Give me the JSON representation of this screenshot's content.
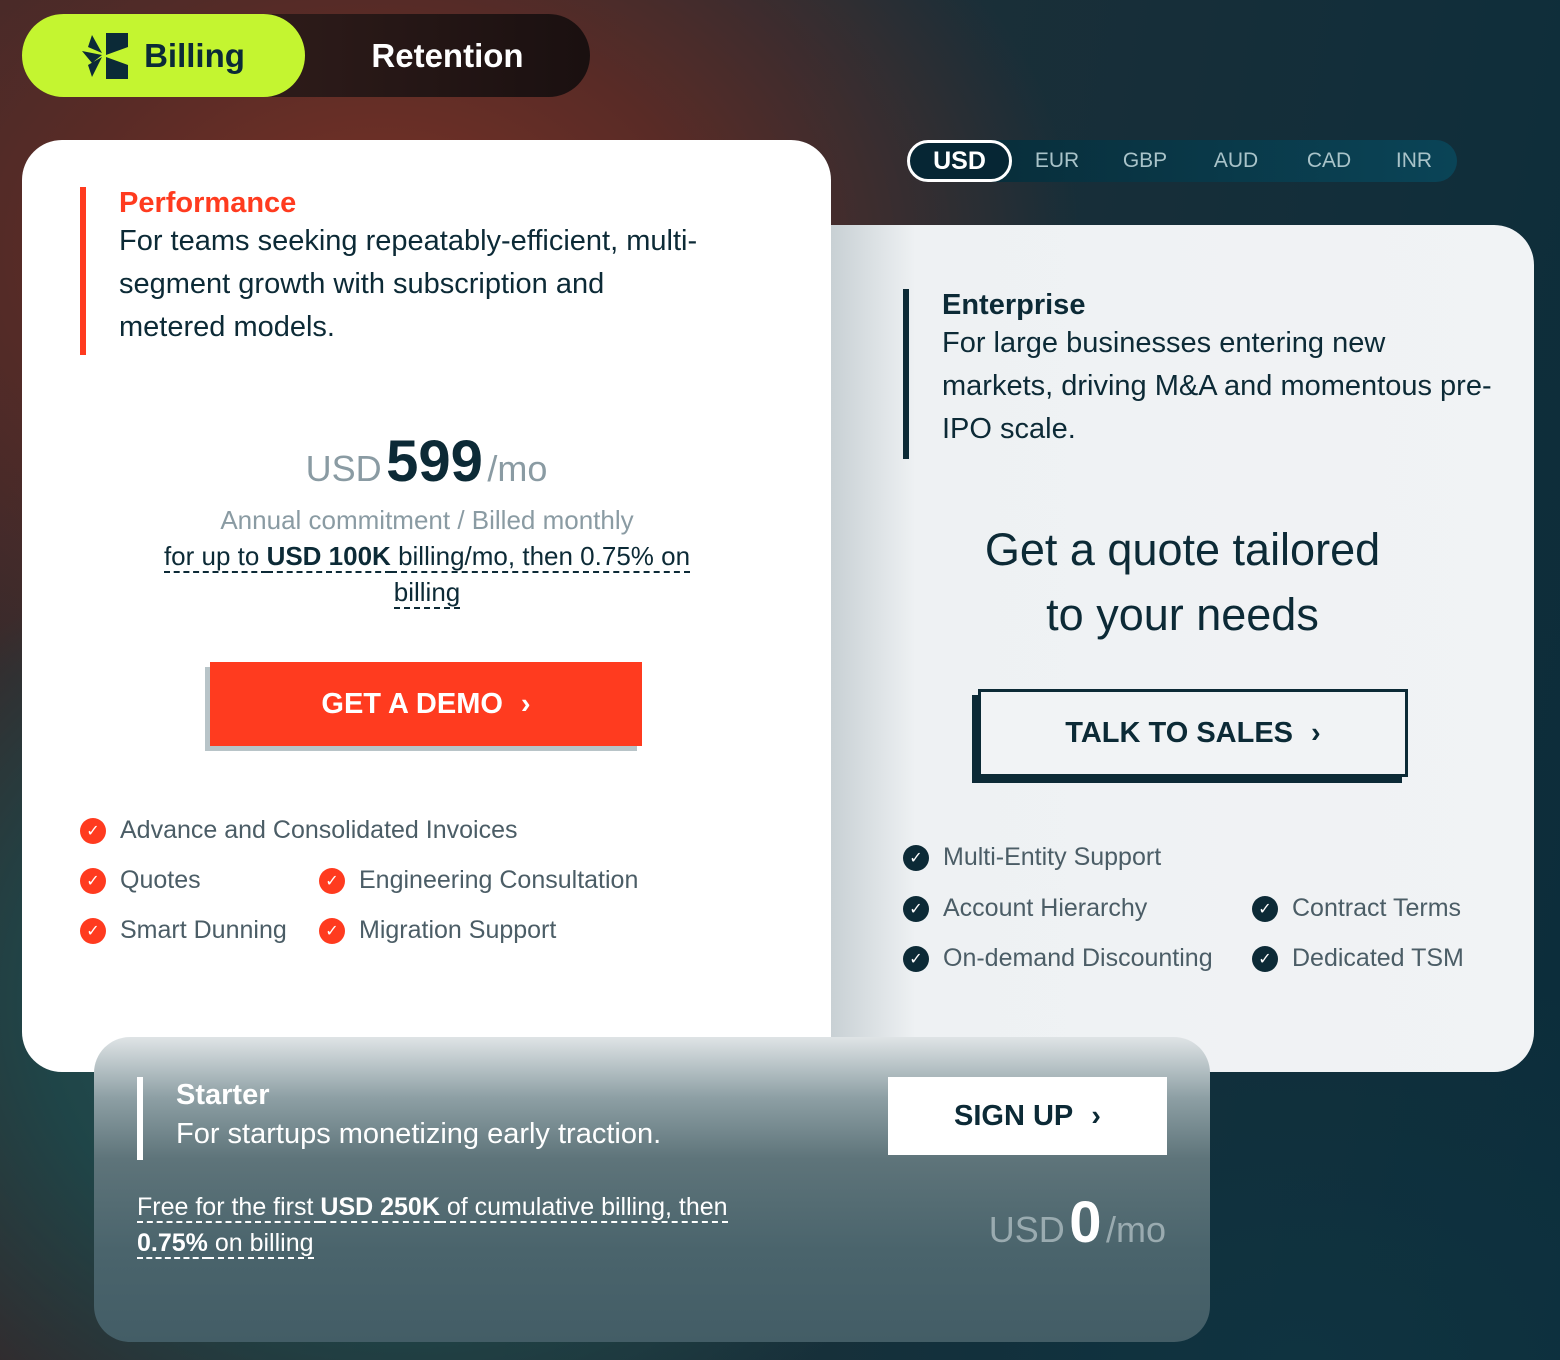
{
  "tabs": {
    "billing": "Billing",
    "retention": "Retention"
  },
  "currencies": [
    "USD",
    "EUR",
    "GBP",
    "AUD",
    "CAD",
    "INR"
  ],
  "selected_currency": "USD",
  "colors": {
    "accent_lime": "#c4f530",
    "accent_red": "#ff3b1f",
    "navy": "#0c2a36"
  },
  "performance": {
    "title": "Performance",
    "description": "For teams seeking repeatably-efficient, multi-segment growth with subscription and metered models.",
    "currency": "USD",
    "amount": "599",
    "period": "/mo",
    "commitment": "Annual commitment / Billed monthly",
    "note_pre": "for up to ",
    "note_bold": "USD 100K",
    "note_post": " billing/mo, then 0.75% on billing",
    "cta": "GET A DEMO",
    "features": [
      "Advance and Consolidated Invoices",
      "Quotes",
      "Engineering Consultation",
      "Smart Dunning",
      "Migration Support"
    ]
  },
  "enterprise": {
    "title": "Enterprise",
    "description": "For large businesses entering new markets, driving M&A and momentous pre-IPO scale.",
    "quote_line1": "Get a quote tailored",
    "quote_line2": "to your needs",
    "cta": "TALK TO SALES",
    "features": [
      "Multi-Entity Support",
      "Account Hierarchy",
      "Contract Terms",
      "On-demand Discounting",
      "Dedicated TSM"
    ]
  },
  "starter": {
    "title": "Starter",
    "description": "For startups monetizing early traction.",
    "note_pre": "Free for the first ",
    "note_bold": "USD 250K",
    "note_mid": " of cumulative billing, then ",
    "note_bold2": "0.75%",
    "note_post": " on billing",
    "cta": "SIGN UP",
    "currency": "USD",
    "amount": "0",
    "period": "/mo"
  }
}
